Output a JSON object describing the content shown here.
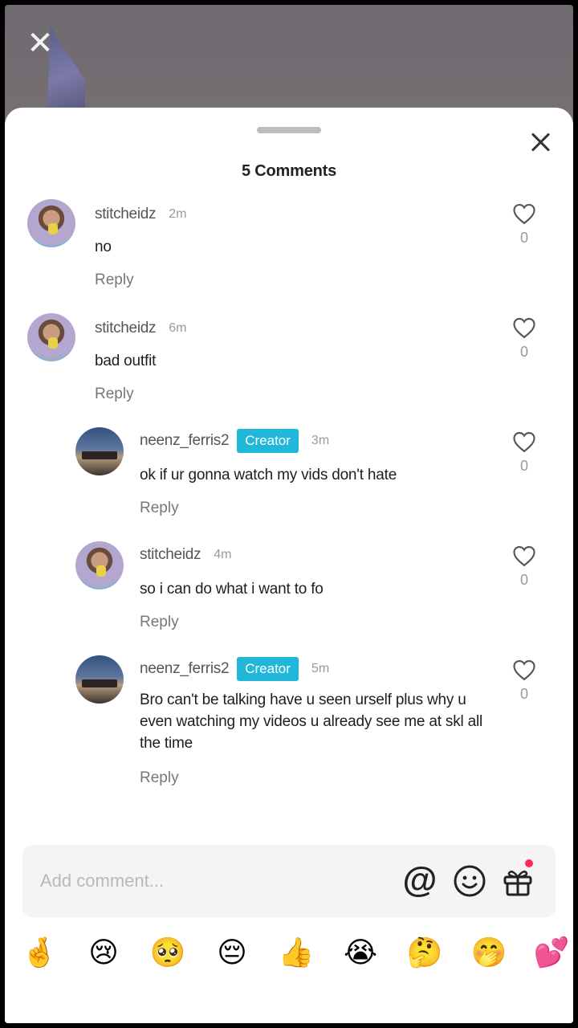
{
  "background": {
    "close_icon": "close-icon"
  },
  "sheet": {
    "title": "5 Comments",
    "close_icon": "close-icon"
  },
  "comments": [
    {
      "username": "stitcheidz",
      "creator": "",
      "time": "2m",
      "text": "no",
      "reply": "Reply",
      "likes": "0"
    },
    {
      "username": "stitcheidz",
      "creator": "",
      "time": "6m",
      "text": "bad outfit",
      "reply": "Reply",
      "likes": "0"
    },
    {
      "username": "neenz_ferris2",
      "creator": "Creator",
      "time": "3m",
      "text": "ok if ur gonna watch my vids don't hate",
      "reply": "Reply",
      "likes": "0"
    },
    {
      "username": "stitcheidz",
      "creator": "",
      "time": "4m",
      "text": "so i can do what i want to fo",
      "reply": "Reply",
      "likes": "0"
    },
    {
      "username": "neenz_ferris2",
      "creator": "Creator",
      "time": "5m",
      "text": "Bro can't be talking have u seen urself plus why u even watching my videos u already see me at skl all the time",
      "reply": "Reply",
      "likes": "0"
    }
  ],
  "composer": {
    "placeholder": "Add comment...",
    "mention_label": "@",
    "icons": [
      "at-icon",
      "emoji-icon",
      "gift-icon"
    ],
    "accent": "#fe2c55"
  },
  "emoji_bar": [
    "🤞",
    "😢",
    "🥺",
    "😔",
    "👍",
    "😭",
    "🤔",
    "🤭",
    "💕"
  ],
  "colors": {
    "creator_badge": "#20b7d8",
    "text": "#1e1e1e",
    "muted": "#999999"
  }
}
